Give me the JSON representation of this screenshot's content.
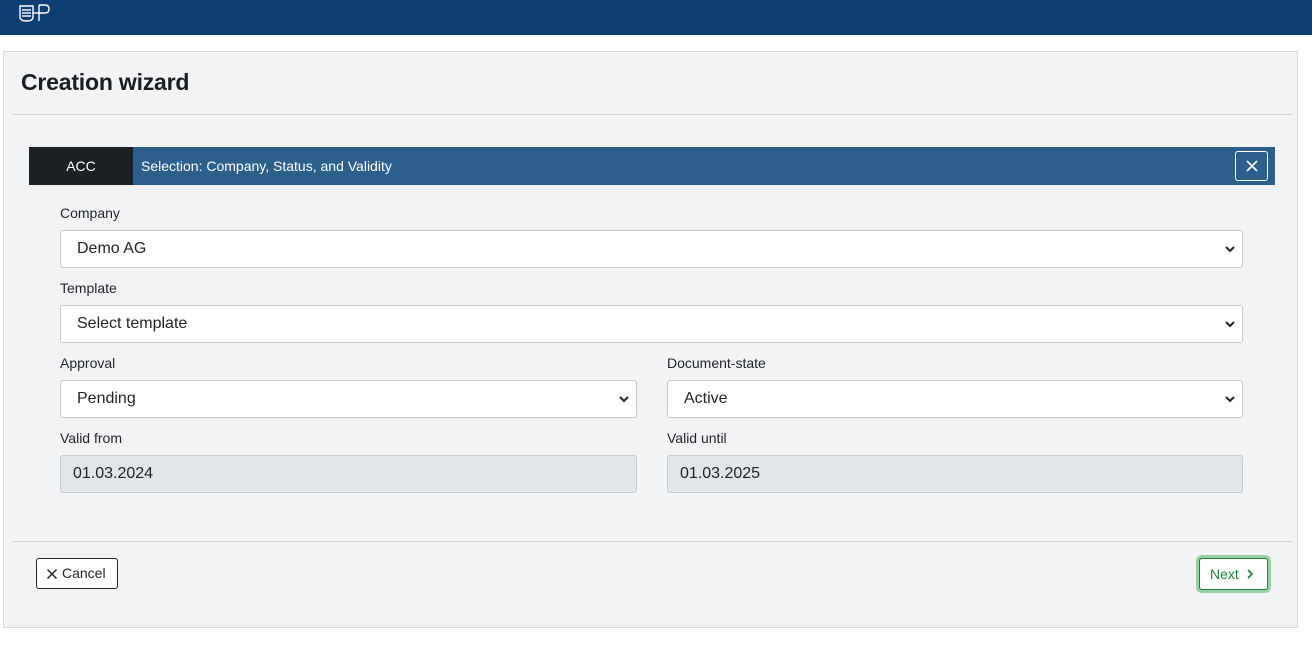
{
  "header": {
    "logo_alt": "EP"
  },
  "page": {
    "title": "Creation wizard"
  },
  "step": {
    "code": "ACC",
    "title": "Selection: Company, Status, and Validity"
  },
  "form": {
    "company": {
      "label": "Company",
      "value": "Demo AG"
    },
    "template": {
      "label": "Template",
      "value": "Select template"
    },
    "approval": {
      "label": "Approval",
      "value": "Pending"
    },
    "document_state": {
      "label": "Document-state",
      "value": "Active"
    },
    "valid_from": {
      "label": "Valid from",
      "value": "01.03.2024"
    },
    "valid_until": {
      "label": "Valid until",
      "value": "01.03.2025"
    }
  },
  "footer": {
    "cancel_label": "Cancel",
    "next_label": "Next"
  },
  "colors": {
    "topbar": "#0e3e72",
    "stepbar": "#2c5f8c",
    "step_code_bg": "#1d2024",
    "next_green": "#1f7e36"
  }
}
